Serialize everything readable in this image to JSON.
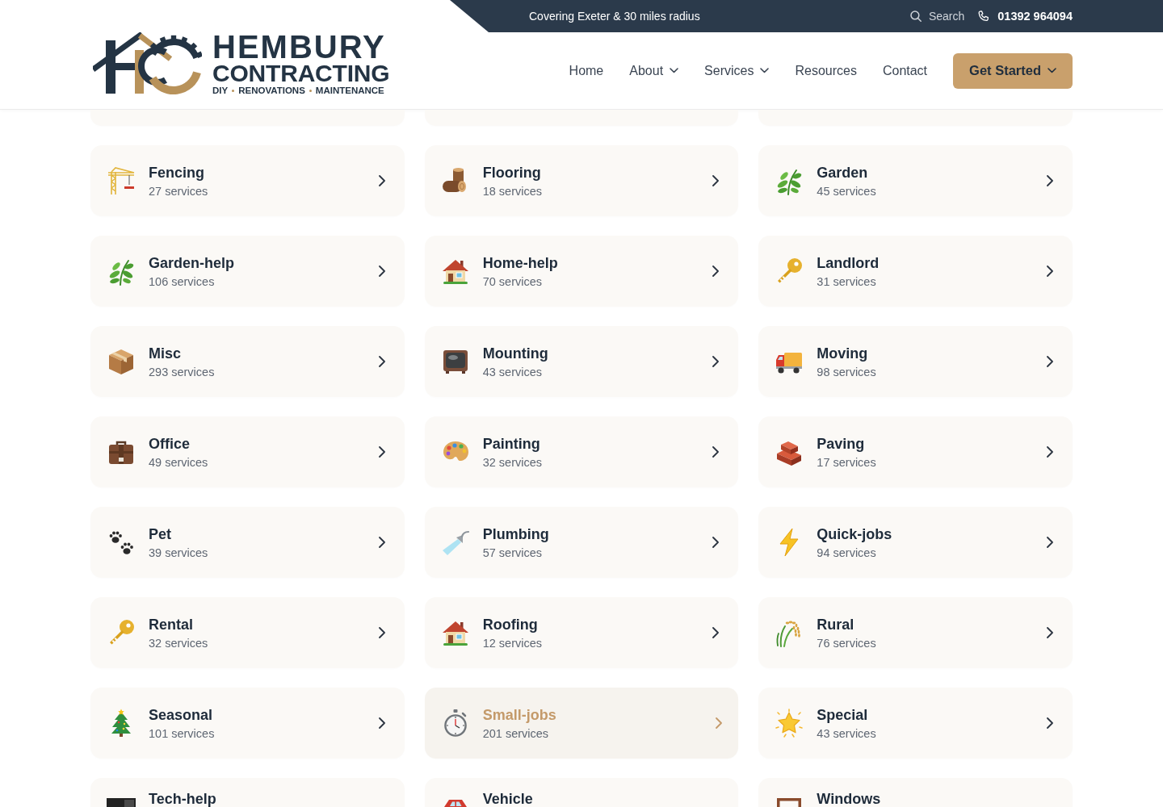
{
  "top_bar": {
    "message": "Covering Exeter & 30 miles radius",
    "search": {
      "label": "Search"
    },
    "phone": {
      "number": "01392 964094"
    }
  },
  "logo": {
    "name": "HEMBURY",
    "subtitle": "CONTRACTING",
    "tagline": [
      "DIY",
      "RENOVATIONS",
      "MAINTENANCE"
    ]
  },
  "nav": {
    "items": [
      {
        "label": "Home",
        "dropdown": false
      },
      {
        "label": "About",
        "dropdown": true
      },
      {
        "label": "Services",
        "dropdown": true
      },
      {
        "label": "Resources",
        "dropdown": false
      },
      {
        "label": "Contact",
        "dropdown": false
      }
    ],
    "cta": {
      "label": "Get Started",
      "dropdown": true
    }
  },
  "categories": [
    {
      "kind": "covered"
    },
    {
      "kind": "covered"
    },
    {
      "kind": "covered"
    },
    {
      "kind": "full",
      "title": "Fencing",
      "count": "27 services",
      "selected": false
    },
    {
      "kind": "full",
      "title": "Flooring",
      "count": "18 services",
      "selected": false
    },
    {
      "kind": "full",
      "title": "Garden",
      "count": "45 services",
      "selected": false
    },
    {
      "kind": "full",
      "title": "Garden-help",
      "count": "106 services",
      "selected": false
    },
    {
      "kind": "full",
      "title": "Home-help",
      "count": "70 services",
      "selected": false
    },
    {
      "kind": "full",
      "title": "Landlord",
      "count": "31 services",
      "selected": false
    },
    {
      "kind": "full",
      "title": "Misc",
      "count": "293 services",
      "selected": false
    },
    {
      "kind": "full",
      "title": "Mounting",
      "count": "43 services",
      "selected": false
    },
    {
      "kind": "full",
      "title": "Moving",
      "count": "98 services",
      "selected": false
    },
    {
      "kind": "full",
      "title": "Office",
      "count": "49 services",
      "selected": false
    },
    {
      "kind": "full",
      "title": "Painting",
      "count": "32 services",
      "selected": false
    },
    {
      "kind": "full",
      "title": "Paving",
      "count": "17 services",
      "selected": false
    },
    {
      "kind": "full",
      "title": "Pet",
      "count": "39 services",
      "selected": false
    },
    {
      "kind": "full",
      "title": "Plumbing",
      "count": "57 services",
      "selected": false
    },
    {
      "kind": "full",
      "title": "Quick-jobs",
      "count": "94 services",
      "selected": false
    },
    {
      "kind": "full",
      "title": "Rental",
      "count": "32 services",
      "selected": false
    },
    {
      "kind": "full",
      "title": "Roofing",
      "count": "12 services",
      "selected": false
    },
    {
      "kind": "full",
      "title": "Rural",
      "count": "76 services",
      "selected": false
    },
    {
      "kind": "full",
      "title": "Seasonal",
      "count": "101 services",
      "selected": false
    },
    {
      "kind": "full",
      "title": "Small-jobs",
      "count": "201 services",
      "selected": true
    },
    {
      "kind": "full",
      "title": "Special",
      "count": "43 services",
      "selected": false
    },
    {
      "kind": "cut",
      "title": "Tech-help",
      "selected": false
    },
    {
      "kind": "cut",
      "title": "Vehicle",
      "selected": false
    },
    {
      "kind": "cut",
      "title": "Windows",
      "selected": false
    }
  ]
}
